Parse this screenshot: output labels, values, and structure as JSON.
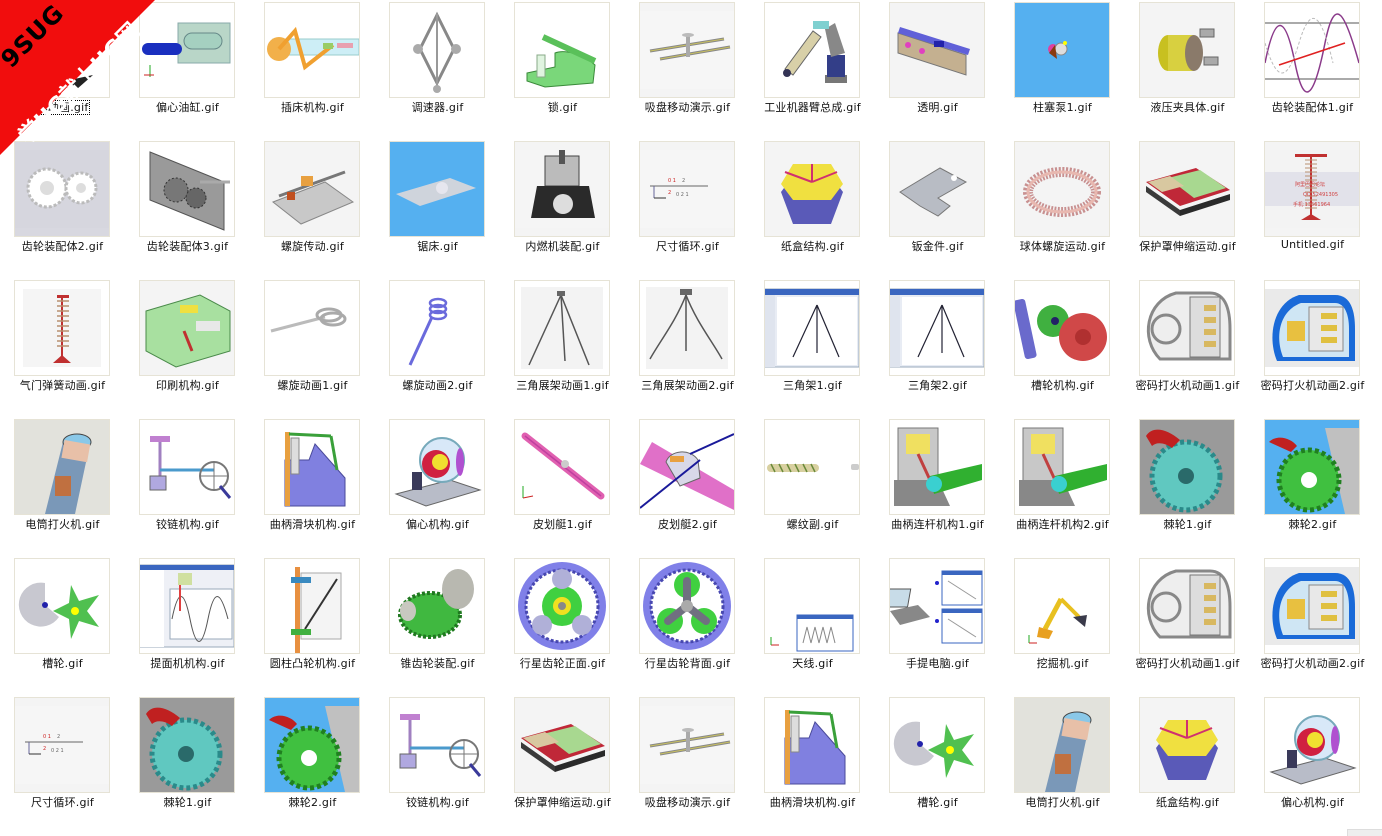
{
  "watermark": {
    "line1": "9SUG",
    "line2": "学UG就上UG网",
    "color": "#f10d0d"
  },
  "selected_index": 0,
  "rows": [
    [
      {
        "name": "体动画.gif",
        "icon": "animation-thumbnail",
        "bg": "#ffffff"
      },
      {
        "name": "偏心油缸.gif",
        "icon": "hydraulic-cylinder-thumbnail",
        "bg": "#ffffff"
      },
      {
        "name": "插床机构.gif",
        "icon": "slotting-machine-thumbnail",
        "bg": "#ffffff"
      },
      {
        "name": "调速器.gif",
        "icon": "governor-thumbnail",
        "bg": "#ffffff"
      },
      {
        "name": "锁.gif",
        "icon": "lock-clamp-thumbnail",
        "bg": "#ffffff"
      },
      {
        "name": "吸盘移动演示.gif",
        "icon": "suction-cup-thumbnail",
        "bg": "#f4f4f4"
      },
      {
        "name": "工业机器臂总成.gif",
        "icon": "robot-arm-thumbnail",
        "bg": "#ffffff"
      },
      {
        "name": "透明.gif",
        "icon": "track-thumbnail",
        "bg": "#f4f4f4"
      },
      {
        "name": "柱塞泵1.gif",
        "icon": "plunger-pump-thumbnail",
        "bg": "#55b0f0"
      },
      {
        "name": "液压夹具体.gif",
        "icon": "hydraulic-fixture-thumbnail",
        "bg": "#f4f4f4"
      },
      {
        "name": "齿轮装配体1.gif",
        "icon": "gear-curve-thumbnail",
        "bg": "#ffffff"
      }
    ],
    [
      {
        "name": "齿轮装配体2.gif",
        "icon": "gear-pair-thumbnail",
        "bg": "#d8d8e0"
      },
      {
        "name": "齿轮装配体3.gif",
        "icon": "gearbox-thumbnail",
        "bg": "#ffffff"
      },
      {
        "name": "螺旋传动.gif",
        "icon": "screw-drive-thumbnail",
        "bg": "#f4f4f4"
      },
      {
        "name": "锯床.gif",
        "icon": "sawing-machine-thumbnail",
        "bg": "#55b0f0"
      },
      {
        "name": "内燃机装配.gif",
        "icon": "engine-thumbnail",
        "bg": "#f4f4f4"
      },
      {
        "name": "尺寸循环.gif",
        "icon": "dimension-chain-thumbnail",
        "bg": "#f4f4f4"
      },
      {
        "name": "纸盒结构.gif",
        "icon": "paper-box-thumbnail",
        "bg": "#f4f4f4"
      },
      {
        "name": "钣金件.gif",
        "icon": "sheet-metal-thumbnail",
        "bg": "#f4f4f4"
      },
      {
        "name": "球体螺旋运动.gif",
        "icon": "sphere-spiral-thumbnail",
        "bg": "#f4f4f4"
      },
      {
        "name": "保护罩伸缩运动.gif",
        "icon": "bellows-cover-thumbnail",
        "bg": "#f4f4f4"
      },
      {
        "name": "Untitled.gif",
        "icon": "valve-spring-watermark-thumbnail",
        "bg": "#f4f4f4"
      }
    ],
    [
      {
        "name": "气门弹簧动画.gif",
        "icon": "valve-spring-thumbnail",
        "bg": "#ffffff"
      },
      {
        "name": "印刷机构.gif",
        "icon": "printing-mechanism-thumbnail",
        "bg": "#f4f4f4"
      },
      {
        "name": "螺旋动画1.gif",
        "icon": "spiral-spring-thumbnail",
        "bg": "#ffffff"
      },
      {
        "name": "螺旋动画2.gif",
        "icon": "spiral-spring-rod-thumbnail",
        "bg": "#ffffff"
      },
      {
        "name": "三角展架动画1.gif",
        "icon": "tripod-thumbnail",
        "bg": "#ffffff"
      },
      {
        "name": "三角展架动画2.gif",
        "icon": "tripod-open-thumbnail",
        "bg": "#ffffff"
      },
      {
        "name": "三角架1.gif",
        "icon": "tripod-cad-window-thumbnail",
        "bg": "#ffffff"
      },
      {
        "name": "三角架2.gif",
        "icon": "tripod-cad-window-thumbnail",
        "bg": "#ffffff"
      },
      {
        "name": "槽轮机构.gif",
        "icon": "geneva-mechanism-thumbnail",
        "bg": "#ffffff"
      },
      {
        "name": "密码打火机动画1.gif",
        "icon": "lighter-mechanism-thumbnail",
        "bg": "#ffffff"
      },
      {
        "name": "密码打火机动画2.gif",
        "icon": "lighter-mechanism-color-thumbnail",
        "bg": "#ffffff"
      }
    ],
    [
      {
        "name": "电筒打火机.gif",
        "icon": "flashlight-lighter-thumbnail",
        "bg": "#e2e2dc"
      },
      {
        "name": "铰链机构.gif",
        "icon": "hinge-mechanism-thumbnail",
        "bg": "#ffffff"
      },
      {
        "name": "曲柄滑块机构.gif",
        "icon": "crank-slider-thumbnail",
        "bg": "#ffffff"
      },
      {
        "name": "偏心机构.gif",
        "icon": "eccentric-mechanism-thumbnail",
        "bg": "#ffffff"
      },
      {
        "name": "皮划艇1.gif",
        "icon": "paddle-thumbnail",
        "bg": "#ffffff"
      },
      {
        "name": "皮划艇2.gif",
        "icon": "kayak-thumbnail",
        "bg": "#ffffff"
      },
      {
        "name": "螺纹副.gif",
        "icon": "thread-pair-thumbnail",
        "bg": "#ffffff"
      },
      {
        "name": "曲柄连杆机构1.gif",
        "icon": "piston-crank-thumbnail",
        "bg": "#ffffff"
      },
      {
        "name": "曲柄连杆机构2.gif",
        "icon": "piston-crank-thumbnail",
        "bg": "#ffffff"
      },
      {
        "name": "棘轮1.gif",
        "icon": "ratchet-thumbnail",
        "bg": "#9a9a9a"
      },
      {
        "name": "棘轮2.gif",
        "icon": "ratchet-green-thumbnail",
        "bg": "#55b0f0"
      }
    ],
    [
      {
        "name": "槽轮.gif",
        "icon": "geneva-wheel-thumbnail",
        "bg": "#ffffff"
      },
      {
        "name": "提面机机构.gif",
        "icon": "cad-graph-window-thumbnail",
        "bg": "#ffffff"
      },
      {
        "name": "圆柱凸轮机构.gif",
        "icon": "cylinder-cam-thumbnail",
        "bg": "#ffffff"
      },
      {
        "name": "锥齿轮装配.gif",
        "icon": "bevel-gear-thumbnail",
        "bg": "#ffffff"
      },
      {
        "name": "行星齿轮正面.gif",
        "icon": "planetary-gear-front-thumbnail",
        "bg": "#ffffff"
      },
      {
        "name": "行星齿轮背面.gif",
        "icon": "planetary-gear-back-thumbnail",
        "bg": "#ffffff"
      },
      {
        "name": "天线.gif",
        "icon": "antenna-graph-thumbnail",
        "bg": "#ffffff"
      },
      {
        "name": "手提电脑.gif",
        "icon": "laptop-graph-thumbnail",
        "bg": "#ffffff"
      },
      {
        "name": "挖掘机.gif",
        "icon": "excavator-thumbnail",
        "bg": "#ffffff"
      },
      {
        "name": "密码打火机动画1.gif",
        "icon": "lighter-mechanism-thumbnail",
        "bg": "#ffffff"
      },
      {
        "name": "密码打火机动画2.gif",
        "icon": "lighter-mechanism-color-thumbnail",
        "bg": "#ffffff"
      }
    ],
    [
      {
        "name": "尺寸循环.gif",
        "icon": "dimension-chain-thumbnail",
        "bg": "#f4f4f4"
      },
      {
        "name": "棘轮1.gif",
        "icon": "ratchet-thumbnail",
        "bg": "#9a9a9a"
      },
      {
        "name": "棘轮2.gif",
        "icon": "ratchet-green-thumbnail",
        "bg": "#55b0f0"
      },
      {
        "name": "铰链机构.gif",
        "icon": "hinge-mechanism-thumbnail",
        "bg": "#ffffff"
      },
      {
        "name": "保护罩伸缩运动.gif",
        "icon": "bellows-cover-thumbnail",
        "bg": "#f4f4f4"
      },
      {
        "name": "吸盘移动演示.gif",
        "icon": "suction-cup-thumbnail",
        "bg": "#f4f4f4"
      },
      {
        "name": "曲柄滑块机构.gif",
        "icon": "crank-slider-thumbnail",
        "bg": "#ffffff"
      },
      {
        "name": "槽轮.gif",
        "icon": "geneva-wheel-thumbnail",
        "bg": "#ffffff"
      },
      {
        "name": "电筒打火机.gif",
        "icon": "flashlight-lighter-thumbnail",
        "bg": "#e2e2dc"
      },
      {
        "name": "纸盒结构.gif",
        "icon": "paper-box-thumbnail",
        "bg": "#f4f4f4"
      },
      {
        "name": "偏心机构.gif",
        "icon": "eccentric-mechanism-thumbnail",
        "bg": "#ffffff"
      }
    ]
  ]
}
